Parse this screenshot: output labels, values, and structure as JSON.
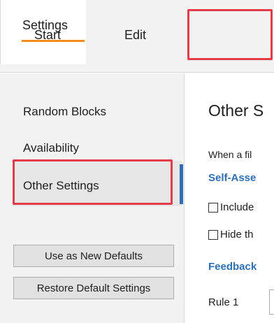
{
  "tabs": {
    "start": "Start",
    "edit": "Edit",
    "settings": "Settings"
  },
  "sidebar": {
    "items": [
      {
        "label": "Random Blocks",
        "selected": false
      },
      {
        "label": "Availability",
        "selected": false
      },
      {
        "label": "Other Settings",
        "selected": true
      }
    ],
    "use_defaults_label": "Use as New Defaults",
    "restore_label": "Restore Default Settings"
  },
  "content": {
    "title": "Other S",
    "description": "When a fil",
    "section_self_assessment": "Self-Asse",
    "checkbox_1_label": "Include",
    "checkbox_2_label": "Hide th",
    "section_feedback": "Feedback",
    "rule_label": "Rule 1"
  },
  "colors": {
    "accent_underline": "#f28a1a",
    "highlight_box": "#e33b4a",
    "section_heading": "#2e6fb3"
  }
}
